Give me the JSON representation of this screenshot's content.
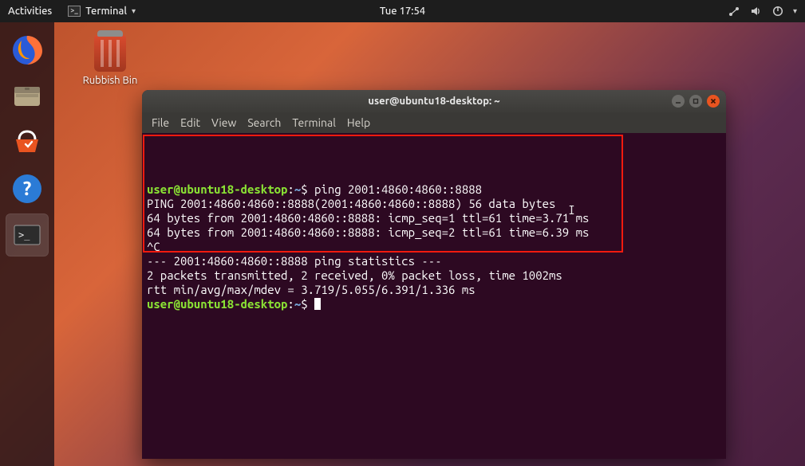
{
  "topbar": {
    "activities": "Activities",
    "active_app": "Terminal",
    "clock": "Tue 17:54"
  },
  "desktop": {
    "rubbish_label": "Rubbish Bin"
  },
  "dock": {
    "items": [
      "firefox",
      "files",
      "software",
      "help",
      "terminal"
    ]
  },
  "terminal": {
    "title": "user@ubuntu18-desktop: ~",
    "menu": {
      "file": "File",
      "edit": "Edit",
      "view": "View",
      "search": "Search",
      "terminal": "Terminal",
      "help": "Help"
    },
    "prompt_user": "user@ubuntu18-desktop",
    "prompt_sep": ":",
    "prompt_path": "~",
    "prompt_symbol": "$",
    "lines": {
      "cmd1": " ping 2001:4860:4860::8888",
      "l1": "PING 2001:4860:4860::8888(2001:4860:4860::8888) 56 data bytes",
      "l2": "64 bytes from 2001:4860:4860::8888: icmp_seq=1 ttl=61 time=3.71 ms",
      "l3": "64 bytes from 2001:4860:4860::8888: icmp_seq=2 ttl=61 time=6.39 ms",
      "l4": "^C",
      "l5": "--- 2001:4860:4860::8888 ping statistics ---",
      "l6": "2 packets transmitted, 2 received, 0% packet loss, time 1002ms",
      "l7": "rtt min/avg/max/mdev = 3.719/5.055/6.391/1.336 ms",
      "cmd2": " "
    }
  }
}
